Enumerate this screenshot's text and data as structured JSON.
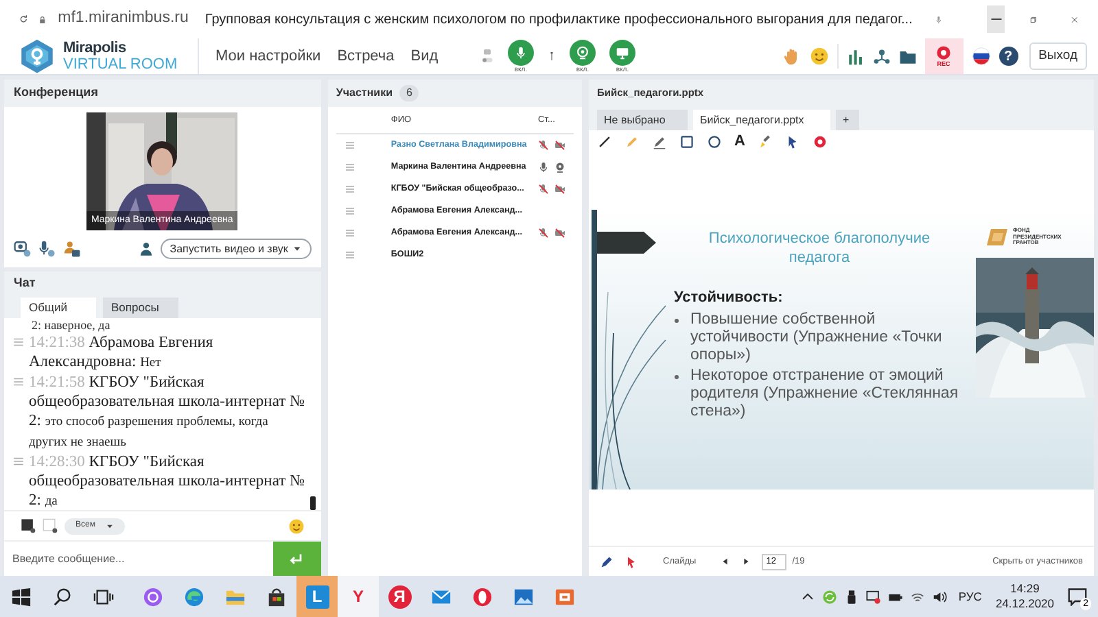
{
  "browser": {
    "url": "mf1.miranimbus.ru",
    "title": "Групповая консультация с женским психологом по профилактике профессионального выгорания для педагог..."
  },
  "app_bar": {
    "logo_top": "Mirapolis",
    "logo_bottom": "VIRTUAL ROOM",
    "menu": [
      "Мои настройки",
      "Встреча",
      "Вид"
    ],
    "media_buttons": [
      {
        "kind": "mic",
        "on": true,
        "label": "вкл."
      },
      {
        "kind": "camera",
        "on": true,
        "label": "вкл."
      },
      {
        "kind": "screen",
        "on": true,
        "label": "вкл."
      }
    ],
    "rec_label": "REC",
    "help_glyph": "?",
    "exit": "Выход"
  },
  "conference": {
    "title": "Конференция",
    "video_caption": "Маркина Валентина Андреевна",
    "start_button": "Запустить видео и звук"
  },
  "chat": {
    "title": "Чат",
    "tabs": [
      {
        "label": "Общий",
        "selected": true
      },
      {
        "label": "Вопросы",
        "selected": false
      }
    ],
    "messages": [
      {
        "kind": "continuation",
        "text": "2: наверное, да"
      },
      {
        "kind": "message",
        "time": "14:21:38",
        "author": "Абрамова  Евгения Александровна:",
        "text": "Нет"
      },
      {
        "kind": "message",
        "time": "14:21:58",
        "author": "КГБОУ \"Бийская общеобразовательная школа-интернат № 2:",
        "text": "это способ разрешения проблемы, когда других не знаешь"
      },
      {
        "kind": "message",
        "time": "14:28:30",
        "author": "КГБОУ \"Бийская общеобразовательная школа-интернат № 2:",
        "text": "да"
      }
    ],
    "recipient": "Всем",
    "placeholder": "Введите сообщение..."
  },
  "participants": {
    "title": "Участники",
    "count": "6",
    "columns": [
      "ФИО",
      "Ст..."
    ],
    "rows": [
      {
        "name": "Разно Светлана  Владимировна",
        "highlighted": true,
        "icons": [
          {
            "kind": "mic-off"
          },
          {
            "kind": "cam-off"
          }
        ]
      },
      {
        "name": "Маркина Валентина  Андреевна",
        "highlighted": false,
        "icons": [
          {
            "kind": "mic-on"
          },
          {
            "kind": "webcam"
          }
        ]
      },
      {
        "name": "КГБОУ \"Бийская общеобразо...",
        "highlighted": false,
        "icons": [
          {
            "kind": "mic-off"
          },
          {
            "kind": "cam-off"
          }
        ]
      },
      {
        "name": "Абрамова  Евгения  Александ...",
        "highlighted": false
      },
      {
        "name": "Абрамова  Евгения  Александ...",
        "highlighted": false,
        "icons": [
          {
            "kind": "mic-off"
          },
          {
            "kind": "cam-off"
          }
        ]
      },
      {
        "name": "БОШИ2",
        "highlighted": false
      }
    ]
  },
  "presentation": {
    "title": "Бийск_педагоги.pptx",
    "tabs": [
      {
        "label": "Не выбрано",
        "selected": false
      },
      {
        "label": "Бийск_педагоги.pptx",
        "selected": true
      },
      {
        "label": "+",
        "selected": false
      }
    ],
    "tools": [
      {
        "kind": "line"
      },
      {
        "kind": "marker"
      },
      {
        "kind": "pencil"
      },
      {
        "kind": "rectangle"
      },
      {
        "kind": "circle"
      },
      {
        "kind": "text",
        "glyph": "A"
      },
      {
        "kind": "brush"
      },
      {
        "kind": "pointer"
      },
      {
        "kind": "record"
      }
    ],
    "slide": {
      "title": "Психологическое благополучие педагога",
      "logo_text": "ФОНД ПРЕЗИДЕНТСКИХ ГРАНТОВ",
      "heading": "Устойчивость:",
      "bullets": [
        "Повышение собственной устойчивости (Упражнение «Точки опоры»)",
        "Некоторое отстранение от эмоций родителя (Упражнение «Стеклянная стена»)"
      ]
    },
    "footer": {
      "slides_label": "Слайды",
      "current": "12",
      "total": "/19",
      "hide": "Скрыть от участников"
    }
  },
  "taskbar": {
    "apps": [
      {
        "kind": "windows",
        "selected": false,
        "hovered": false
      },
      {
        "kind": "search",
        "selected": false,
        "hovered": false
      },
      {
        "kind": "task-view",
        "selected": false,
        "hovered": false
      },
      {
        "kind": "assistant",
        "selected": false,
        "hovered": false
      },
      {
        "kind": "edge",
        "selected": false,
        "hovered": false
      },
      {
        "kind": "explorer",
        "selected": false,
        "hovered": false
      },
      {
        "kind": "store",
        "selected": false,
        "hovered": false
      },
      {
        "kind": "letter-blue",
        "glyph": "L",
        "selected": true,
        "hovered": false
      },
      {
        "kind": "letter-y",
        "glyph": "Y",
        "selected": false,
        "hovered": true
      },
      {
        "kind": "letter-red",
        "glyph": "Я",
        "selected": false,
        "hovered": false
      },
      {
        "kind": "mail",
        "selected": false,
        "hovered": false
      },
      {
        "kind": "opera",
        "selected": false,
        "hovered": false
      },
      {
        "kind": "photos",
        "selected": false,
        "hovered": false
      },
      {
        "kind": "slides-app",
        "selected": false,
        "hovered": false
      }
    ],
    "tray": [
      {
        "kind": "chevron"
      },
      {
        "kind": "sync"
      },
      {
        "kind": "usb"
      },
      {
        "kind": "meeting"
      },
      {
        "kind": "battery"
      },
      {
        "kind": "wifi"
      },
      {
        "kind": "volume"
      }
    ],
    "language": "РУС",
    "time": "14:29",
    "date": "24.12.2020",
    "notifications": "2"
  }
}
